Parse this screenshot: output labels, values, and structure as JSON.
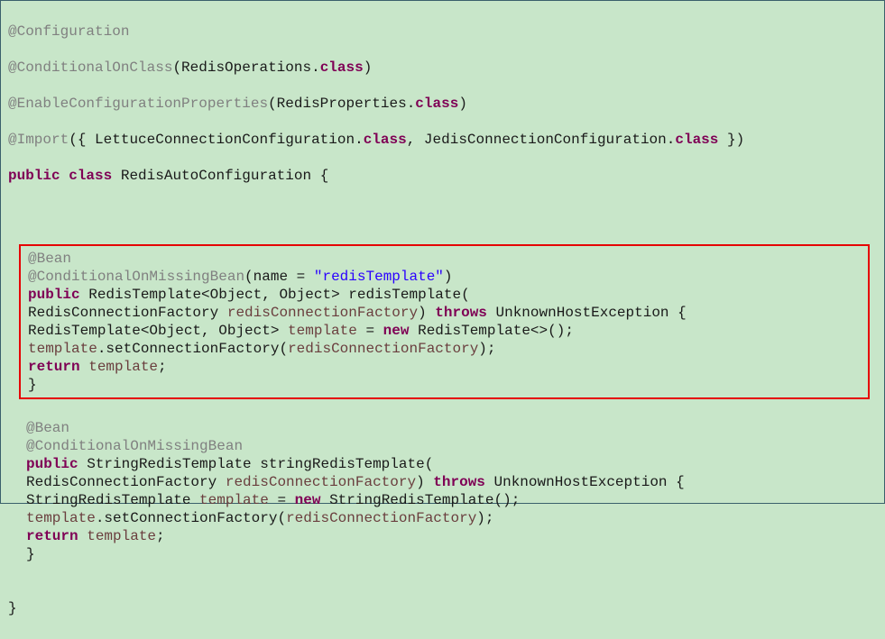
{
  "line1": {
    "anno": "@Configuration"
  },
  "line2": {
    "anno": "@ConditionalOnClass",
    "p1": "(",
    "cls": "RedisOperations",
    "dot": ".",
    "kw": "class",
    "p2": ")"
  },
  "line3": {
    "anno": "@EnableConfigurationProperties",
    "p1": "(",
    "cls": "RedisProperties",
    "dot": ".",
    "kw": "class",
    "p2": ")"
  },
  "line4": {
    "anno": "@Import",
    "p1": "({ ",
    "cls1": "LettuceConnectionConfiguration",
    "dot1": ".",
    "kw1": "class",
    "sep": ", ",
    "cls2": "JedisConnectionConfiguration",
    "dot2": ".",
    "kw2": "class",
    "p2": " })"
  },
  "line5": {
    "kw1": "public",
    "sp1": " ",
    "kw2": "class",
    "sp2": " ",
    "cls": "RedisAutoConfiguration",
    "sp3": " ",
    "brace": "{"
  },
  "block1": {
    "l1": {
      "anno": "@Bean"
    },
    "l2": {
      "anno": "@ConditionalOnMissingBean",
      "p1": "(",
      "name": "name",
      "eq": " = ",
      "str": "\"redisTemplate\"",
      "p2": ")"
    },
    "l3": {
      "kw": "public",
      "sp": " ",
      "type": "RedisTemplate<Object, Object> ",
      "method": "redisTemplate",
      "p": "("
    },
    "l4": {
      "indent": "        ",
      "type": "RedisConnectionFactory ",
      "param": "redisConnectionFactory",
      "p1": ") ",
      "kw": "throws",
      "sp": " ",
      "exc": "UnknownHostException {"
    },
    "l5": {
      "indent": "    ",
      "type": "RedisTemplate<Object, Object> ",
      "var": "template",
      "eq": " = ",
      "kw": "new",
      "sp": " ",
      "ctor": "RedisTemplate<>();"
    },
    "l6": {
      "indent": "    ",
      "var": "template",
      "dot": ".",
      "call": "setConnectionFactory(",
      "param": "redisConnectionFactory",
      "p": ");"
    },
    "l7": {
      "indent": "    ",
      "kw": "return",
      "sp": " ",
      "var": "template",
      "p": ";"
    },
    "l8": {
      "brace": "}"
    }
  },
  "block2": {
    "l1": {
      "anno": "@Bean"
    },
    "l2": {
      "anno": "@ConditionalOnMissingBean"
    },
    "l3": {
      "kw": "public",
      "sp": " ",
      "type": "StringRedisTemplate ",
      "method": "stringRedisTemplate",
      "p": "("
    },
    "l4": {
      "indent": "        ",
      "type": "RedisConnectionFactory ",
      "param": "redisConnectionFactory",
      "p1": ") ",
      "kw": "throws",
      "sp": " ",
      "exc": "UnknownHostException {"
    },
    "l5": {
      "indent": "    ",
      "type": "StringRedisTemplate ",
      "var": "template",
      "eq": " = ",
      "kw": "new",
      "sp": " ",
      "ctor": "StringRedisTemplate();"
    },
    "l6": {
      "indent": "    ",
      "var": "template",
      "dot": ".",
      "call": "setConnectionFactory(",
      "param": "redisConnectionFactory",
      "p": ");"
    },
    "l7": {
      "indent": "    ",
      "kw": "return",
      "sp": " ",
      "var": "template",
      "p": ";"
    },
    "l8": {
      "brace": "}"
    }
  },
  "lastbrace": "}"
}
